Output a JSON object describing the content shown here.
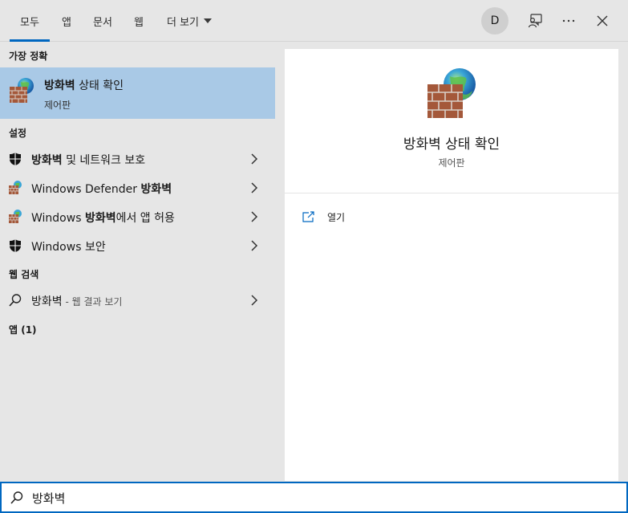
{
  "tabs": [
    {
      "label": "모두",
      "active": true
    },
    {
      "label": "앱",
      "active": false
    },
    {
      "label": "문서",
      "active": false
    },
    {
      "label": "웹",
      "active": false
    },
    {
      "label": "더 보기",
      "active": false
    }
  ],
  "header": {
    "avatar_initial": "D",
    "icons": [
      "feedback-icon",
      "more-icon",
      "close-icon"
    ]
  },
  "sections": {
    "best_match": "가장 정확",
    "settings": "설정",
    "web_search": "웹 검색",
    "apps": "앱 (1)"
  },
  "best_match": {
    "title_bold": "방화벽",
    "title_rest": " 상태 확인",
    "subtitle": "제어판",
    "icon": "firewall-icon"
  },
  "settings_items": [
    {
      "bold": "방화벽",
      "rest": " 및 네트워크 보호",
      "icon": "shield-icon"
    },
    {
      "pre": "Windows Defender ",
      "bold": "방화벽",
      "icon": "firewall-icon"
    },
    {
      "pre": "Windows ",
      "bold": "방화벽",
      "rest": "에서 앱 허용",
      "icon": "firewall-icon"
    },
    {
      "pre": "Windows 보안",
      "icon": "shield-icon"
    }
  ],
  "web_item": {
    "query": "방화벽",
    "suffix": " - 웹 결과 보기",
    "icon": "search-icon"
  },
  "detail": {
    "title": "방화벽 상태 확인",
    "subtitle": "제어판",
    "actions": [
      {
        "label": "열기",
        "icon": "open-icon"
      }
    ]
  },
  "search": {
    "value": "방화벽",
    "icon": "search-icon"
  },
  "colors": {
    "accent": "#0067c0",
    "selected": "#a9c9e6",
    "background": "#e6e6e6"
  }
}
